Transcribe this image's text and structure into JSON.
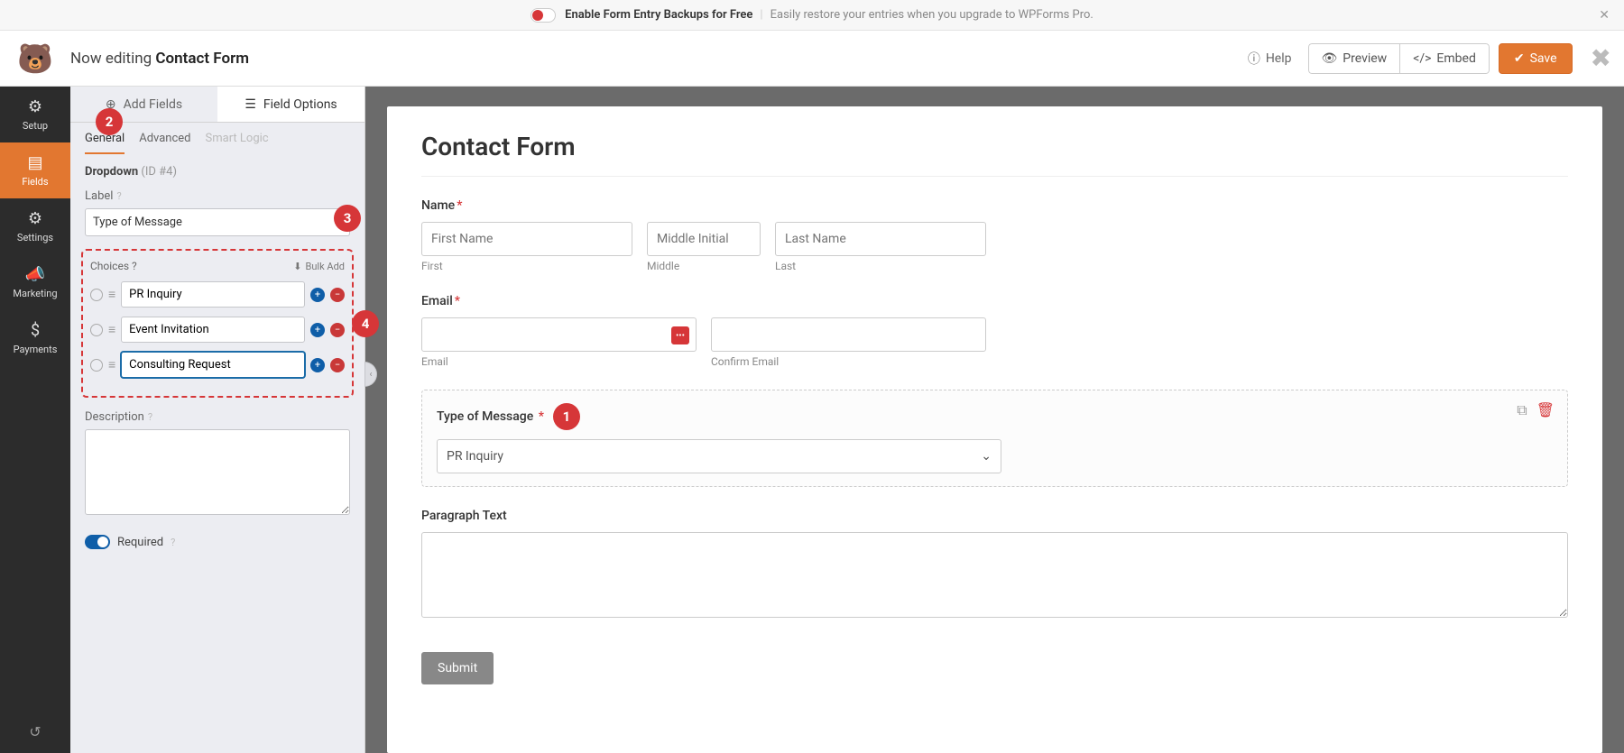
{
  "banner": {
    "bold": "Enable Form Entry Backups for Free",
    "light": "Easily restore your entries when you upgrade to WPForms Pro."
  },
  "header": {
    "editing": "Now editing ",
    "form_name": "Contact Form",
    "help": "Help",
    "preview": "Preview",
    "embed": "Embed",
    "save": "Save"
  },
  "rail": {
    "items": [
      {
        "label": "Setup",
        "icon": "⚙"
      },
      {
        "label": "Fields",
        "icon": "☰"
      },
      {
        "label": "Settings",
        "icon": "⚙"
      },
      {
        "label": "Marketing",
        "icon": "📣"
      },
      {
        "label": "Payments",
        "icon": "$"
      }
    ]
  },
  "panel": {
    "tabs": {
      "add": "Add Fields",
      "options": "Field Options"
    },
    "subtabs": {
      "general": "General",
      "advanced": "Advanced",
      "smart": "Smart Logic"
    },
    "field_name": "Dropdown",
    "field_id": "(ID #4)",
    "label_lbl": "Label",
    "label_val": "Type of Message",
    "choices_lbl": "Choices",
    "bulk": "Bulk Add",
    "choices": [
      "PR Inquiry",
      "Event Invitation",
      "Consulting Request"
    ],
    "desc_lbl": "Description",
    "required": "Required"
  },
  "form": {
    "title": "Contact Form",
    "name": {
      "label": "Name",
      "first_ph": "First Name",
      "middle_ph": "Middle Initial",
      "last_ph": "Last Name",
      "first": "First",
      "middle": "Middle",
      "last": "Last"
    },
    "email": {
      "label": "Email",
      "email_sub": "Email",
      "confirm_sub": "Confirm Email"
    },
    "dropdown": {
      "label": "Type of Message",
      "selected": "PR Inquiry"
    },
    "paragraph": {
      "label": "Paragraph Text"
    },
    "submit": "Submit"
  },
  "annotations": {
    "1": "1",
    "2": "2",
    "3": "3",
    "4": "4"
  }
}
